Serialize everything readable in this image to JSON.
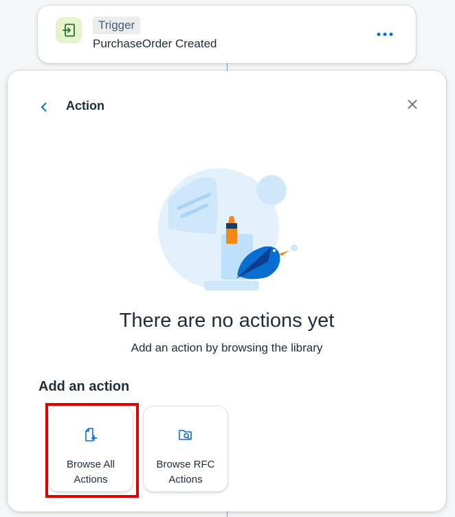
{
  "trigger": {
    "tag": "Trigger",
    "subtitle": "PurchaseOrder Created",
    "icon": "enter-icon",
    "more_icon": "more-icon"
  },
  "panel": {
    "title": "Action",
    "back_icon": "chevron-left-icon",
    "close_icon": "close-icon"
  },
  "empty_state": {
    "title": "There are no actions yet",
    "subtitle": "Add an action by browsing the library"
  },
  "add_action": {
    "heading": "Add an action",
    "tiles": [
      {
        "label": "Browse All Actions",
        "icon": "add-document-icon",
        "highlighted": true
      },
      {
        "label": "Browse RFC Actions",
        "icon": "folder-search-icon",
        "highlighted": false
      }
    ]
  },
  "colors": {
    "accent": "#0a6ed1",
    "trigger_icon_bg": "#e5f4cb",
    "trigger_icon_fg": "#256f3a",
    "highlight": "#e00000",
    "text": "#1d2d3e"
  }
}
